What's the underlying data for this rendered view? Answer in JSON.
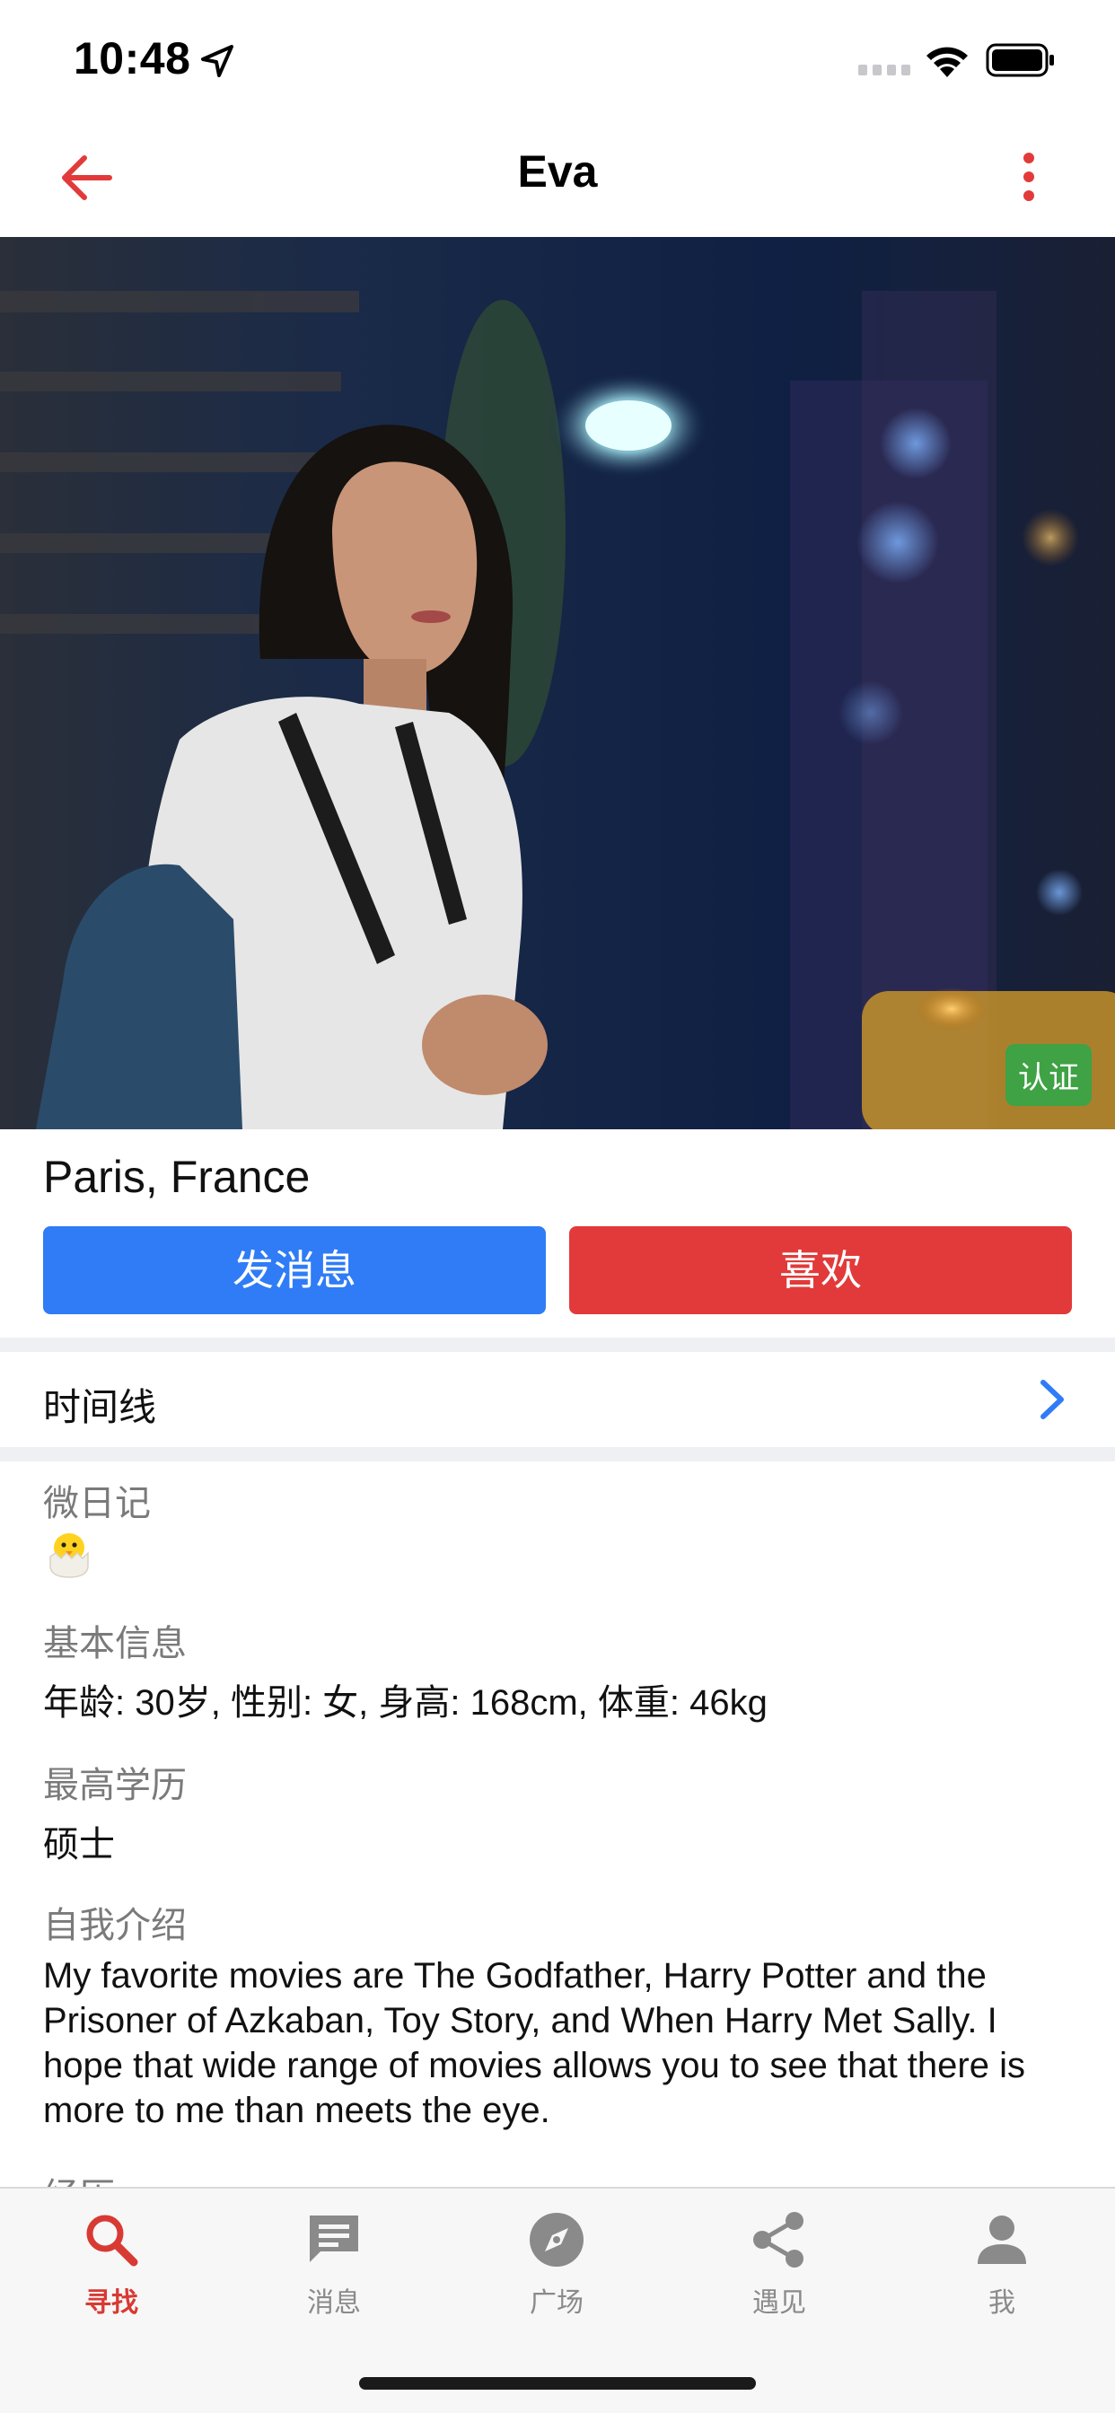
{
  "status_bar": {
    "time": "10:48"
  },
  "nav": {
    "title": "Eva"
  },
  "photo": {
    "verified_badge": "认证"
  },
  "profile": {
    "location": "Paris, France"
  },
  "actions": {
    "message_label": "发消息",
    "like_label": "喜欢"
  },
  "timeline": {
    "label": "时间线"
  },
  "sections": {
    "micro_diary": {
      "label": "微日记",
      "value_icon": "hatching-chick-emoji"
    },
    "basic_info": {
      "label": "基本信息",
      "value": "年龄: 30岁, 性别: 女, 身高: 168cm, 体重: 46kg"
    },
    "education": {
      "label": "最高学历",
      "value": "硕士"
    },
    "intro": {
      "label": "自我介绍",
      "value": "My favorite movies are The Godfather, Harry Potter and the Prisoner of Azkaban, Toy Story, and When Harry Met Sally. I hope that wide range of movies allows you to see that there is more to me than meets the eye."
    },
    "experience": {
      "label": "经历"
    }
  },
  "tabs": [
    {
      "label": "寻找",
      "icon": "search-icon",
      "active": true
    },
    {
      "label": "消息",
      "icon": "message-icon",
      "active": false
    },
    {
      "label": "广场",
      "icon": "compass-icon",
      "active": false
    },
    {
      "label": "遇见",
      "icon": "share-icon",
      "active": false
    },
    {
      "label": "我",
      "icon": "person-icon",
      "active": false
    }
  ],
  "colors": {
    "accent_red": "#e23a3a",
    "accent_blue": "#2f7cf6",
    "verified_green": "#3fa244",
    "tab_active": "#d83a33"
  }
}
